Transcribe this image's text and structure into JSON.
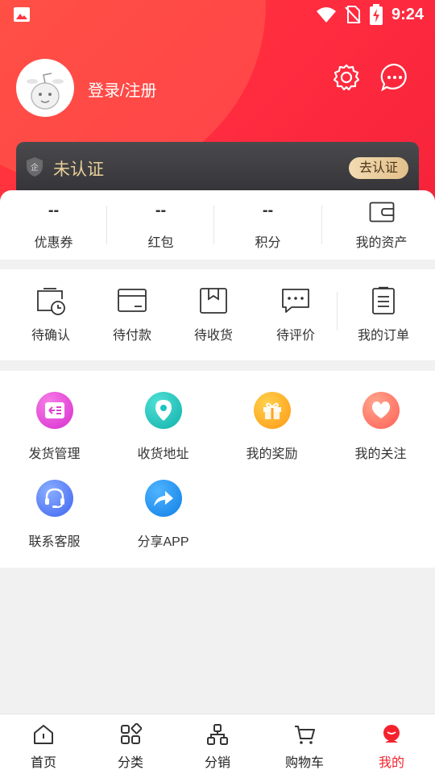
{
  "status_bar": {
    "time": "9:24",
    "icons": [
      "image-icon",
      "wifi-icon",
      "no-sim-icon",
      "battery-charging-icon"
    ]
  },
  "header": {
    "login_label": "登录/注册",
    "accent": "#ff2b3f"
  },
  "certification": {
    "status": "未认证",
    "button": "去认证"
  },
  "assets": [
    {
      "value": "--",
      "label": "优惠券"
    },
    {
      "value": "--",
      "label": "红包"
    },
    {
      "value": "--",
      "label": "积分"
    },
    {
      "label": "我的资产",
      "icon": "wallet-icon"
    }
  ],
  "orders": [
    {
      "label": "待确认",
      "icon": "pending-confirm-icon"
    },
    {
      "label": "待付款",
      "icon": "card-icon"
    },
    {
      "label": "待收货",
      "icon": "receive-box-icon"
    },
    {
      "label": "待评价",
      "icon": "comment-icon"
    },
    {
      "label": "我的订单",
      "icon": "order-list-icon"
    }
  ],
  "services": [
    {
      "label": "发货管理",
      "icon": "shipping-icon",
      "color": "#e040d0"
    },
    {
      "label": "收货地址",
      "icon": "location-icon",
      "color": "#1bc4c0"
    },
    {
      "label": "我的奖励",
      "icon": "gift-icon",
      "color": "#ffa51f"
    },
    {
      "label": "我的关注",
      "icon": "heart-icon",
      "color": "#ff7563"
    },
    {
      "label": "联系客服",
      "icon": "headset-icon",
      "color": "#4c7cf7"
    },
    {
      "label": "分享APP",
      "icon": "share-icon",
      "color": "#1a8cf0"
    }
  ],
  "tabbar": [
    {
      "label": "首页",
      "icon": "home-icon"
    },
    {
      "label": "分类",
      "icon": "category-icon"
    },
    {
      "label": "分销",
      "icon": "distribution-icon"
    },
    {
      "label": "购物车",
      "icon": "cart-icon"
    },
    {
      "label": "我的",
      "icon": "profile-icon",
      "active": true,
      "color": "#f5222d"
    }
  ]
}
